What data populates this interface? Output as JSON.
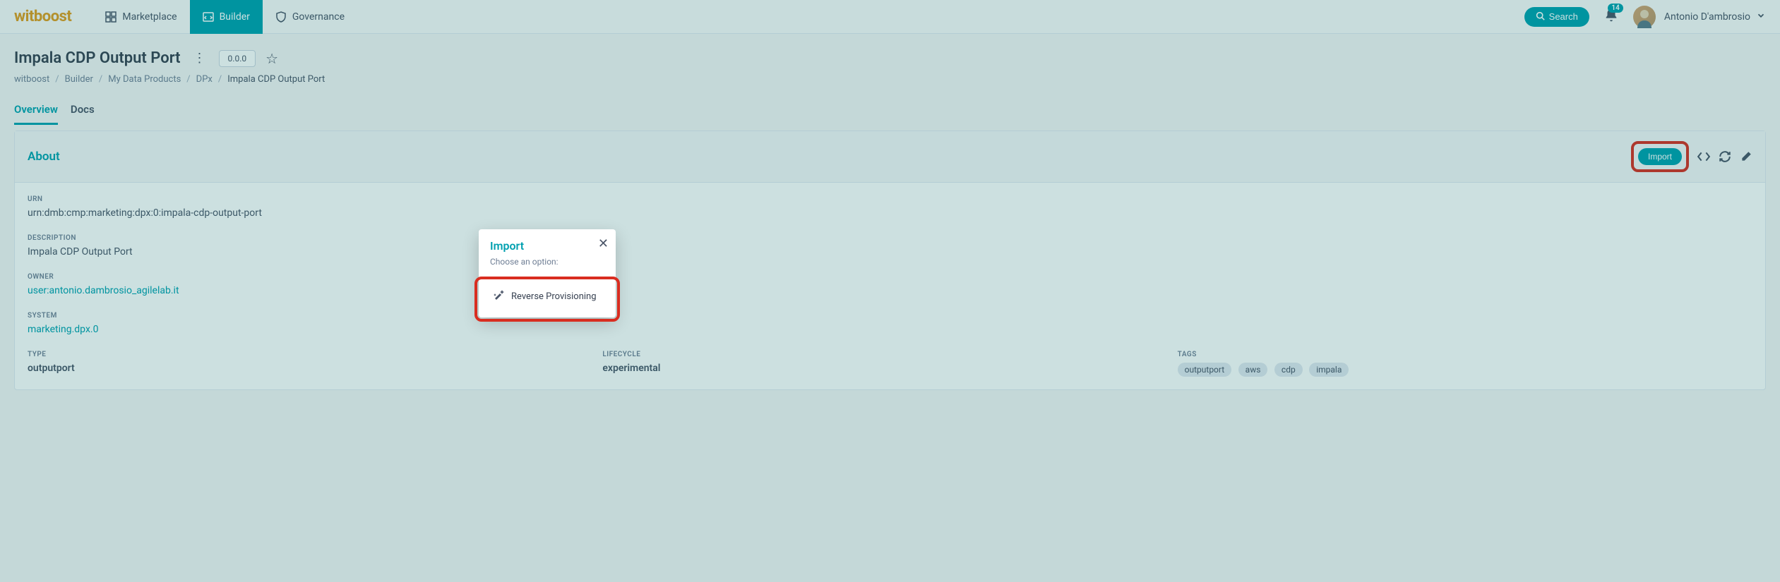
{
  "brand": "witboost",
  "nav": {
    "marketplace": "Marketplace",
    "builder": "Builder",
    "governance": "Governance",
    "search_label": "Search",
    "notif_count": "14",
    "user_name": "Antonio D'ambrosio"
  },
  "page": {
    "title": "Impala CDP Output Port",
    "version": "0.0.0"
  },
  "breadcrumb": {
    "items": [
      "witboost",
      "Builder",
      "My Data Products",
      "DPx",
      "Impala CDP Output Port"
    ]
  },
  "tabs": {
    "overview": "Overview",
    "docs": "Docs"
  },
  "about": {
    "header": "About",
    "import_btn": "Import",
    "urn_label": "URN",
    "urn": "urn:dmb:cmp:marketing:dpx:0:impala-cdp-output-port",
    "description_label": "DESCRIPTION",
    "description": "Impala CDP Output Port",
    "owner_label": "OWNER",
    "owner": "user:antonio.dambrosio_agilelab.it",
    "system_label": "SYSTEM",
    "system": "marketing.dpx.0",
    "type_label": "TYPE",
    "type": "outputport",
    "lifecycle_label": "LIFECYCLE",
    "lifecycle": "experimental",
    "tags_label": "TAGS",
    "tags": [
      "outputport",
      "aws",
      "cdp",
      "impala"
    ]
  },
  "modal": {
    "title": "Import",
    "subtitle": "Choose an option:",
    "option_label": "Reverse Provisioning"
  }
}
